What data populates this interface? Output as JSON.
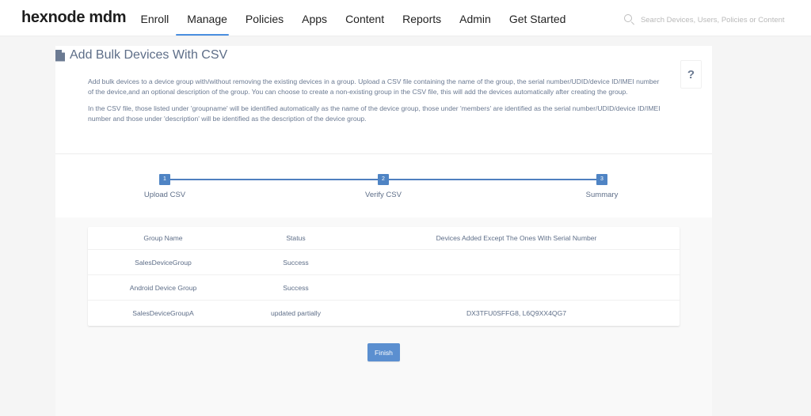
{
  "header": {
    "logo": "hexnode mdm",
    "nav": [
      {
        "label": "Enroll",
        "active": false
      },
      {
        "label": "Manage",
        "active": true
      },
      {
        "label": "Policies",
        "active": false
      },
      {
        "label": "Apps",
        "active": false
      },
      {
        "label": "Content",
        "active": false
      },
      {
        "label": "Reports",
        "active": false
      },
      {
        "label": "Admin",
        "active": false
      },
      {
        "label": "Get Started",
        "active": false
      }
    ],
    "search": {
      "placeholder": "Search Devices, Users, Policies or Content",
      "value": ""
    },
    "accent_color": "#4a8fe0"
  },
  "page": {
    "title": "Add Bulk Devices With CSV",
    "help_label": "?",
    "description": [
      "Add bulk devices to a device group with/without removing the existing devices in a group. Upload a CSV file containing the name of the group, the serial number/UDID/device ID/IMEI number of the device,and an optional description of the group. You can choose to create a non-existing group in the CSV file, this will add the devices automatically after creating the group.",
      "In the CSV file, those listed under 'groupname' will be identified automatically as the name of the device group, those under 'members' are identified as the serial number/UDID/device ID/IMEI number and those under 'description' will be identified as the description of the device group."
    ],
    "steps": [
      {
        "number": "1",
        "label": "Upload CSV"
      },
      {
        "number": "2",
        "label": "Verify CSV"
      },
      {
        "number": "3",
        "label": "Summary"
      }
    ],
    "table": {
      "headers": [
        "Group Name",
        "Status",
        "Devices Added Except The Ones With Serial Number"
      ],
      "rows": [
        [
          "SalesDeviceGroup",
          "Success",
          ""
        ],
        [
          "Android Device Group",
          "Success",
          ""
        ],
        [
          "SalesDeviceGroupA",
          "updated partially",
          "DX3TFU0SFFG8, L6Q9XX4QG7"
        ]
      ]
    },
    "finish_label": "Finish"
  }
}
